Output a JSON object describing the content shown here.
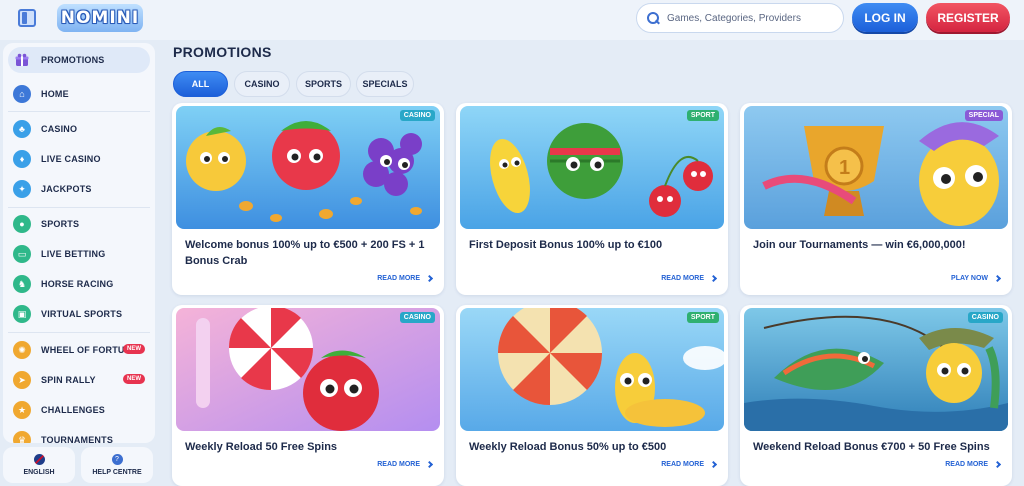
{
  "header": {
    "logo_text": "NOMINI",
    "search_placeholder": "Games, Categories, Providers",
    "login_label": "LOG IN",
    "register_label": "REGISTER"
  },
  "sidebar": {
    "items": [
      {
        "label": "PROMOTIONS",
        "icon": "gift-icon",
        "color": "#7b55d6"
      },
      {
        "label": "HOME",
        "icon": "home-icon",
        "color": "#3d78d8"
      },
      {
        "label": "CASINO",
        "icon": "slots-icon",
        "color": "#3aa0e8"
      },
      {
        "label": "LIVE CASINO",
        "icon": "cards-icon",
        "color": "#3aa0e8"
      },
      {
        "label": "JACKPOTS",
        "icon": "coins-icon",
        "color": "#3aa0e8"
      },
      {
        "label": "SPORTS",
        "icon": "soccer-ball-icon",
        "color": "#2fb88a"
      },
      {
        "label": "LIVE BETTING",
        "icon": "monitor-icon",
        "color": "#2fb88a"
      },
      {
        "label": "HORSE RACING",
        "icon": "horse-icon",
        "color": "#2fb88a"
      },
      {
        "label": "VIRTUAL SPORTS",
        "icon": "virtual-icon",
        "color": "#2fb88a"
      },
      {
        "label": "WHEEL OF FORTUNE",
        "icon": "wheel-icon",
        "color": "#f0a830",
        "badge": "NEW"
      },
      {
        "label": "SPIN RALLY",
        "icon": "rally-icon",
        "color": "#f0a830",
        "badge": "NEW"
      },
      {
        "label": "CHALLENGES",
        "icon": "star-icon",
        "color": "#f0a830"
      },
      {
        "label": "TOURNAMENTS",
        "icon": "trophy-icon",
        "color": "#f0a830"
      }
    ],
    "footer": {
      "language_label": "ENGLISH",
      "help_label": "HELP CENTRE"
    }
  },
  "main": {
    "title": "PROMOTIONS",
    "tabs": [
      {
        "label": "ALL",
        "active": true
      },
      {
        "label": "CASINO"
      },
      {
        "label": "SPORTS"
      },
      {
        "label": "SPECIALS"
      }
    ],
    "cards": [
      {
        "tag": "CASINO",
        "tag_color": "#28a7c8",
        "title": "Welcome bonus 100% up to €500 + 200 FS + 1 Bonus Crab",
        "link": "READ MORE",
        "art": "fruits"
      },
      {
        "tag": "SPORT",
        "tag_color": "#2fb070",
        "title": "First Deposit Bonus 100% up to €100",
        "link": "READ MORE",
        "art": "watermelon"
      },
      {
        "tag": "SPECIAL",
        "tag_color": "#8a5ad6",
        "title": "Join our Tournaments — win €6,000,000!",
        "link": "PLAY NOW",
        "art": "trophy"
      },
      {
        "tag": "CASINO",
        "tag_color": "#28a7c8",
        "title": "Weekly Reload 50 Free Spins",
        "link": "READ MORE",
        "art": "candy"
      },
      {
        "tag": "SPORT",
        "tag_color": "#2fb070",
        "title": "Weekly Reload Bonus 50% up to €500",
        "link": "READ MORE",
        "art": "parachute"
      },
      {
        "tag": "CASINO",
        "tag_color": "#28a7c8",
        "title": "Weekend Reload Bonus €700 + 50 Free Spins",
        "link": "READ MORE",
        "art": "fishing"
      }
    ]
  }
}
